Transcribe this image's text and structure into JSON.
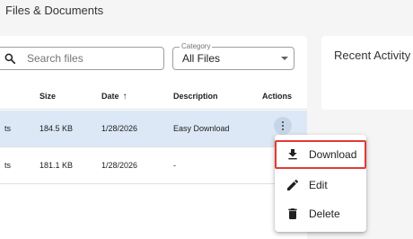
{
  "page": {
    "title": "Files & Documents"
  },
  "search": {
    "placeholder": "Search files",
    "icon": "search-icon"
  },
  "category": {
    "label": "Category",
    "value": "All Files"
  },
  "recent_activity": {
    "title": "Recent Activity"
  },
  "table": {
    "columns": {
      "name_suffix": "",
      "size": "Size",
      "date": "Date",
      "date_sort": "↑",
      "description": "Description",
      "actions": "Actions"
    },
    "rows": [
      {
        "name": "ts",
        "size": "184.5 KB",
        "date": "1/28/2026",
        "description": "Easy Download",
        "selected": true
      },
      {
        "name": "ts",
        "size": "181.1 KB",
        "date": "1/28/2026",
        "description": "-",
        "selected": false
      }
    ]
  },
  "menu": {
    "items": [
      {
        "label": "Download",
        "icon": "download-icon"
      },
      {
        "label": "Edit",
        "icon": "edit-icon"
      },
      {
        "label": "Delete",
        "icon": "delete-icon"
      }
    ],
    "highlight_color": "#e53935"
  },
  "colors": {
    "selected_row": "#dce8f5",
    "background": "#f5f5f5"
  }
}
